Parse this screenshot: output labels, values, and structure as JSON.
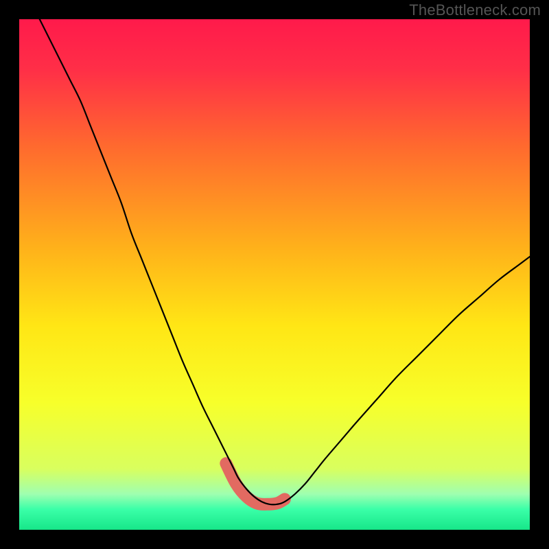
{
  "watermark": "TheBottleneck.com",
  "chart_data": {
    "type": "line",
    "title": "",
    "xlabel": "",
    "ylabel": "",
    "xlim": [
      0,
      100
    ],
    "ylim": [
      0,
      100
    ],
    "gradient_stops": [
      {
        "offset": 0.0,
        "color": "#ff1a4b"
      },
      {
        "offset": 0.1,
        "color": "#ff2f47"
      },
      {
        "offset": 0.25,
        "color": "#ff6a2e"
      },
      {
        "offset": 0.45,
        "color": "#ffb21a"
      },
      {
        "offset": 0.6,
        "color": "#ffe615"
      },
      {
        "offset": 0.75,
        "color": "#f7ff2a"
      },
      {
        "offset": 0.88,
        "color": "#d9ff5e"
      },
      {
        "offset": 0.93,
        "color": "#9fffb0"
      },
      {
        "offset": 0.96,
        "color": "#3affa8"
      },
      {
        "offset": 1.0,
        "color": "#17e689"
      }
    ],
    "series": [
      {
        "name": "bottleneck-curve",
        "type": "line",
        "x": [
          4,
          6,
          8,
          10,
          12,
          14,
          16,
          18,
          20,
          22,
          24,
          26,
          28,
          30,
          32,
          34,
          36,
          38,
          40,
          41,
          42,
          43,
          44.5,
          46,
          47.5,
          49,
          50.5,
          52,
          54,
          56,
          58,
          60,
          63,
          66,
          70,
          74,
          78,
          82,
          86,
          90,
          94,
          98,
          100
        ],
        "y": [
          100,
          96,
          92,
          88,
          84,
          79,
          74,
          69,
          64,
          58,
          53,
          48,
          43,
          38,
          33,
          28.5,
          24,
          20,
          16,
          14,
          12,
          10,
          8,
          6.5,
          5.5,
          5,
          5,
          5.5,
          7,
          9,
          11.5,
          14,
          17.5,
          21,
          25.5,
          30,
          34,
          38,
          42,
          45.5,
          49,
          52,
          53.5
        ]
      },
      {
        "name": "highlight-band",
        "type": "line",
        "stroke": "#e26a61",
        "stroke_width": 18,
        "x": [
          40.5,
          42.5,
          44.5,
          46.5,
          48.5,
          50.5,
          52.0
        ],
        "y": [
          13.0,
          9.0,
          6.5,
          5.2,
          5.0,
          5.2,
          6.0
        ]
      }
    ]
  }
}
